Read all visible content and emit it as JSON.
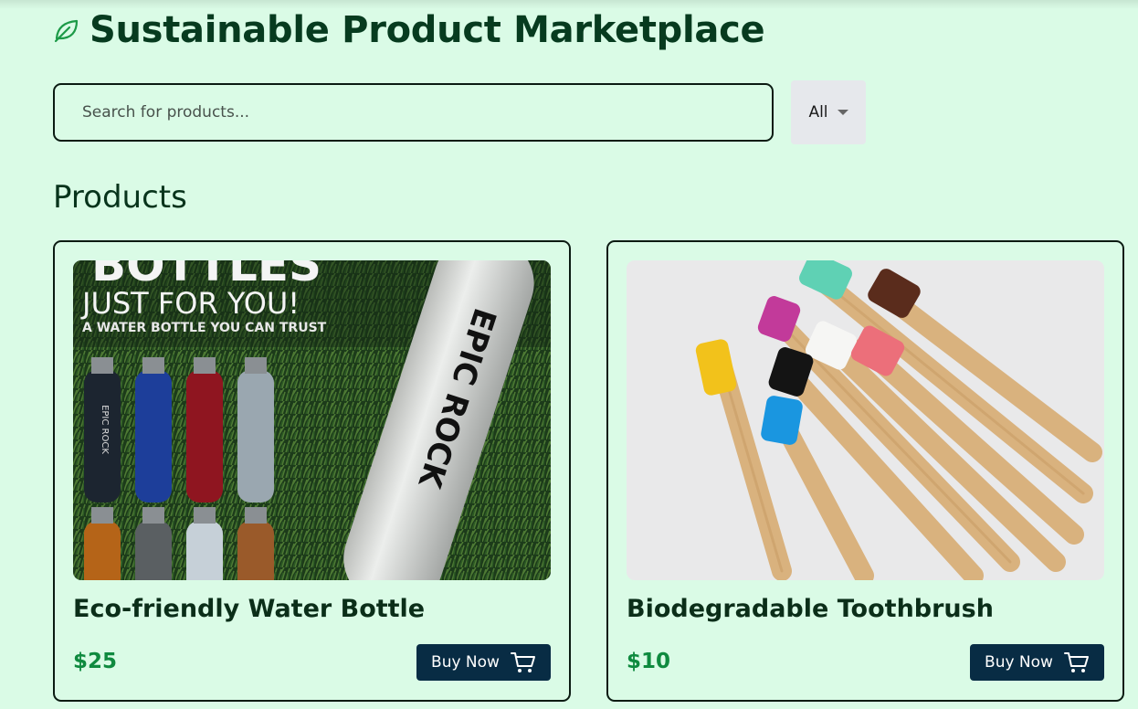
{
  "header": {
    "title": "Sustainable Product Marketplace",
    "icon": "leaf-icon"
  },
  "search": {
    "placeholder": "Search for products..."
  },
  "filter": {
    "selected": "All"
  },
  "section": {
    "title": "Products"
  },
  "products": [
    {
      "name": "Eco-friendly Water Bottle",
      "price": "$25",
      "buy_label": "Buy Now",
      "image": {
        "headline": "BOTTLES",
        "tagline": "JUST FOR YOU!",
        "subline": "A WATER BOTTLE YOU CAN TRUST",
        "brand": "EPIC ROCK",
        "small_brand": "EPIC ROCK"
      }
    },
    {
      "name": "Biodegradable Toothbrush",
      "price": "$10",
      "buy_label": "Buy Now"
    }
  ],
  "colors": {
    "background": "#dafbe6",
    "heading": "#073b1f",
    "price": "#0f8a3f",
    "button": "#082c44",
    "filter_bg": "#e6e8ec"
  }
}
